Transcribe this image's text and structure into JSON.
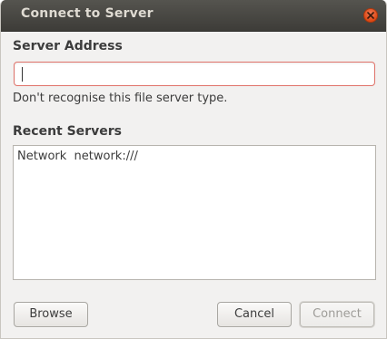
{
  "window": {
    "title": "Connect to Server"
  },
  "form": {
    "server_address_label": "Server Address",
    "server_address_value": "",
    "hint": "Don't recognise this file server type.",
    "recent_servers_label": "Recent Servers"
  },
  "recent_servers": [
    {
      "text": "Network  network:///"
    }
  ],
  "buttons": {
    "browse": "Browse",
    "cancel": "Cancel",
    "connect": "Connect"
  },
  "colors": {
    "titlebar": "#3d3c38",
    "close_button": "#dd4814",
    "input_error_border": "#e0736a",
    "window_bg": "#f2f1f0"
  },
  "icons": {
    "close": "close-icon"
  }
}
